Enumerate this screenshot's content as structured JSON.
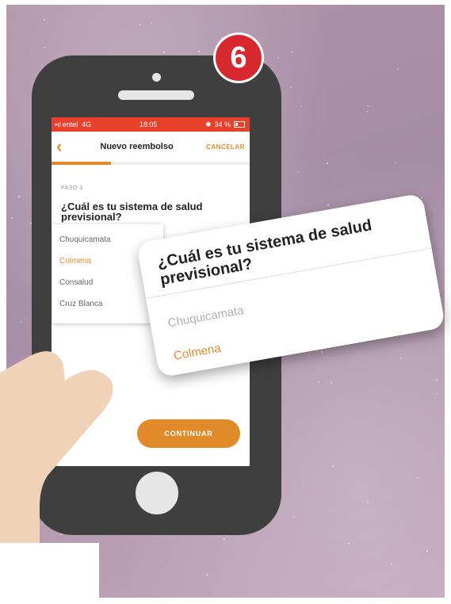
{
  "step_badge": "6",
  "status_bar": {
    "carrier": "entel",
    "network": "4G",
    "time": "18:05",
    "battery": "34 %"
  },
  "nav": {
    "title": "Nuevo reembolso",
    "cancel_label": "CANCELAR"
  },
  "progress": {
    "fraction": 0.3
  },
  "step_label": "PASO 3",
  "question": "¿Cuál es tu sistema de salud previsional?",
  "options": [
    {
      "label": "Chuquicamata",
      "selected": false
    },
    {
      "label": "Colmena",
      "selected": true
    },
    {
      "label": "Consalud",
      "selected": false
    },
    {
      "label": "Cruz Blanca",
      "selected": false
    }
  ],
  "continue_label": "CONTINUAR",
  "zoom": {
    "question": "¿Cuál es tu sistema de salud previsional?",
    "option_first": "Chuquicamata",
    "option_selected": "Colmena"
  },
  "colors": {
    "accent": "#e08a2a",
    "status_bar": "#e8402b",
    "badge": "#d7282f",
    "phone_body": "#3f3f3f"
  }
}
